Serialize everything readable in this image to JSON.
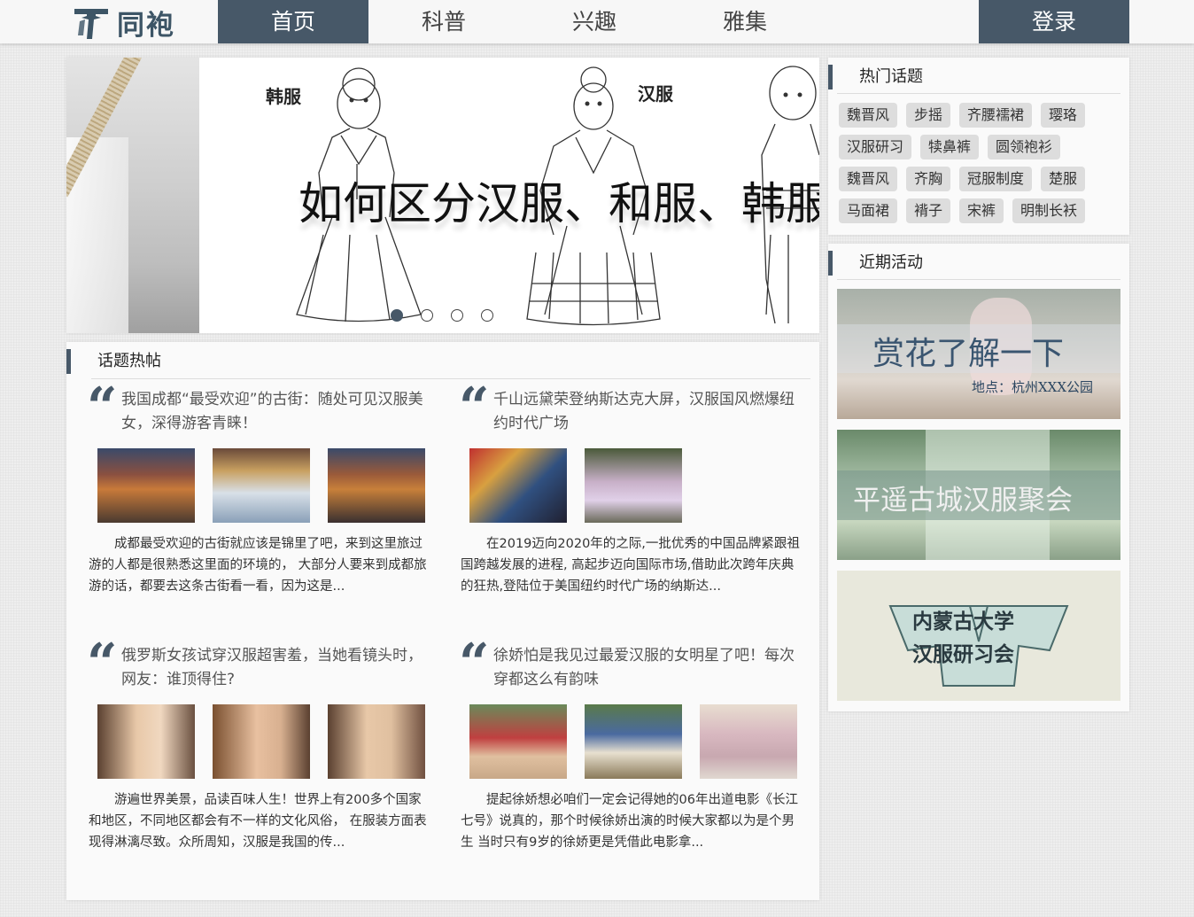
{
  "nav": {
    "logo_text": "同袍",
    "items": [
      {
        "label": "首页",
        "active": true
      },
      {
        "label": "科普",
        "active": false
      },
      {
        "label": "兴趣",
        "active": false
      },
      {
        "label": "雅集",
        "active": false
      }
    ],
    "login_label": "登录",
    "accent_color": "#475868"
  },
  "banner": {
    "tag_left": "韩服",
    "tag_right": "汉服",
    "title": "如何区分汉服、和服、韩服",
    "slide_count": 4,
    "active_slide": 1
  },
  "posts_section": {
    "heading": "话题热帖",
    "posts": [
      {
        "title": "我国成都“最受欢迎”的古街：随处可见汉服美女，深得游客青睐！",
        "excerpt": "成都最受欢迎的古街就应该是锦里了吧，来到这里旅过游的人都是很熟悉这里面的环境的， 大部分人要来到成都旅游的话，都要去这条古街看一看，因为这是...",
        "image_count": 3
      },
      {
        "title": "千山远黛荣登纳斯达克大屏，汉服国风燃爆纽约时代广场",
        "excerpt": "在2019迈向2020年的之际,一批优秀的中国品牌紧跟祖国跨越发展的进程, 高起步迈向国际市场,借助此次跨年庆典的狂热,登陆位于美国纽约时代广场的纳斯达...",
        "image_count": 2
      },
      {
        "title": "俄罗斯女孩试穿汉服超害羞，当她看镜头时，网友：谁顶得住?",
        "excerpt": "游遍世界美景，品读百味人生！世界上有200多个国家和地区，不同地区都会有不一样的文化风俗， 在服装方面表现得淋漓尽致。众所周知，汉服是我国的传...",
        "image_count": 3
      },
      {
        "title": "徐娇怕是我见过最爱汉服的女明星了吧！每次穿都这么有韵味",
        "excerpt": "提起徐娇想必咱们一定会记得她的06年出道电影《长江七号》说真的，那个时候徐娇出演的时候大家都以为是个男生 当时只有9岁的徐娇更是凭借此电影拿...",
        "image_count": 3
      }
    ]
  },
  "topics": {
    "heading": "热门话题",
    "tags": [
      "魏晋风",
      "步摇",
      "齐腰襦裙",
      "璎珞",
      "汉服研习",
      "犊鼻裤",
      "圆领袍衫",
      "魏晋风",
      "齐胸",
      "冠服制度",
      "楚服",
      "马面裙",
      "褙子",
      "宋裤",
      "明制长袄"
    ]
  },
  "events": {
    "heading": "近期活动",
    "items": [
      {
        "title": "赏花了解一下",
        "subtitle": "地点：杭州XXX公园"
      },
      {
        "title": "平遥古城汉服聚会",
        "subtitle": ""
      },
      {
        "title": "内蒙古大学",
        "subtitle": "汉服研习会"
      }
    ]
  }
}
